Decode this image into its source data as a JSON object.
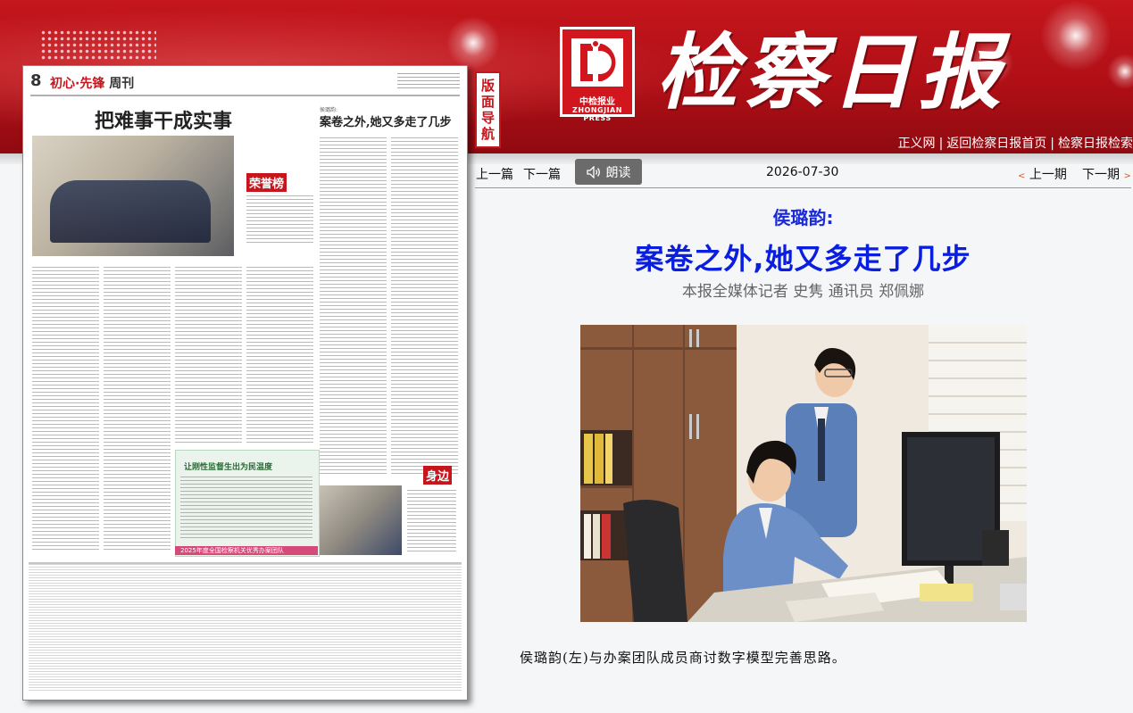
{
  "header": {
    "logo_cn": "中检报业",
    "logo_en": "ZHONGJIAN PRESS",
    "masthead": "检察日报",
    "links": [
      "正义网",
      "返回检察日报首页",
      "检察日报检索"
    ]
  },
  "page_thumbnail": {
    "page_number": "8",
    "section": "初心·先锋",
    "section_suffix": "周刊",
    "title": "把难事干成实事",
    "right_title": "案卷之外,她又多走了几步",
    "right_kicker": "侯璐韵:",
    "badge_honor": "荣誉榜",
    "badge_side": "身边",
    "box_title": "让刚性监督生出为民温度",
    "footer_bar": "2025年度全国检察机关优秀办案团队"
  },
  "nav_tab": [
    "版",
    "面",
    "导",
    "航"
  ],
  "navbar": {
    "prev_article": "上一篇",
    "next_article": "下一篇",
    "read_button": "朗读",
    "date": "2026-07-30",
    "prev_issue": "上一期",
    "next_issue": "下一期"
  },
  "article": {
    "kicker": "侯璐韵:",
    "headline": "案卷之外,她又多走了几步",
    "byline": "本报全媒体记者 史隽 通讯员 郑佩娜",
    "caption": "侯璐韵(左)与办案团队成员商讨数字模型完善思路。"
  },
  "colors": {
    "banner_red": "#c4161c",
    "headline_blue": "#0a1ee0",
    "kicker_blue": "#1a2bd6"
  }
}
